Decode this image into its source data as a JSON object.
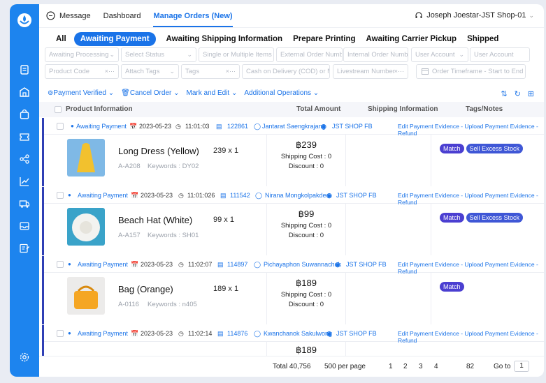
{
  "top_nav": {
    "items": [
      "Message",
      "Dashboard",
      "Manage Orders (New)"
    ],
    "user": "Joseph Joestar-JST Shop-01"
  },
  "status_tabs": [
    "All",
    "Awaiting Payment",
    "Awaiting Shipping Information",
    "Prepare Printing",
    "Awaiting Carrier Pickup",
    "Shipped"
  ],
  "filters": {
    "row1": [
      "Awaiting Processing",
      "Select Status",
      "Single or Multiple Items",
      "External Order Number",
      "Internal Order Number",
      "User Account",
      "User Account"
    ],
    "row2": [
      "Product Code",
      "Attach Tags",
      "Tags",
      "Cash on Delivery (COD) or Not",
      "Livestream Number",
      "Order Timeframe - Start to End"
    ]
  },
  "actions": [
    "Payment Verified",
    "Cancel Order",
    "Mark and Edit",
    "Additional Operations"
  ],
  "table_headers": [
    "Product Information",
    "Total Amount",
    "Shipping Information",
    "Tags/Notes"
  ],
  "orders": [
    {
      "status": "Awaiting Payment",
      "date": "2023-05-23",
      "time": "11:01:03",
      "order_no": "122861",
      "customer": "Jantarat Saengkrajang",
      "shop": "JST SHOP FB",
      "ops": "Edit Payment Evidence - Upload Payment Evidence - Refund",
      "product": "Long Dress (Yellow)",
      "qty": "239 x 1",
      "code": "A-A208",
      "keywords": "Keywords : DY02",
      "amount": "฿239",
      "shipping_cost": "Shipping Cost : 0",
      "discount": "Discount : 0",
      "tags": [
        "Match",
        "Sell Excess Stock"
      ]
    },
    {
      "status": "Awaiting Payment",
      "date": "2023-05-23",
      "time": "11:01:026",
      "order_no": "111542",
      "customer": "Nirana Mongkolpakdee",
      "shop": "JST SHOP FB",
      "ops": "Edit Payment Evidence - Upload Payment Evidence - Refund",
      "product": "Beach Hat (White)",
      "qty": "99 x 1",
      "code": "A-A157",
      "keywords": "Keywords : SH01",
      "amount": "฿99",
      "shipping_cost": "Shipping Cost : 0",
      "discount": "Discount : 0",
      "tags": [
        "Match",
        "Sell Excess Stock"
      ]
    },
    {
      "status": "Awaiting Payment",
      "date": "2023-05-23",
      "time": "11:02:07",
      "order_no": "114897",
      "customer": "Pichayaphon Suwannachok",
      "shop": "JST SHOP FB",
      "ops": "Edit Payment Evidence - Upload Payment Evidence - Refund",
      "product": "Bag (Orange)",
      "qty": "189 x 1",
      "code": "A-0116",
      "keywords": "Keywords : n405",
      "amount": "฿189",
      "shipping_cost": "Shipping Cost : 0",
      "discount": "Discount : 0",
      "tags": [
        "Match"
      ]
    },
    {
      "status": "Awaiting Payment",
      "date": "2023-05-23",
      "time": "11:02:14",
      "order_no": "114876",
      "customer": "Kwanchanok Sakulwong",
      "shop": "JST SHOP FB",
      "ops": "Edit Payment Evidence - Upload Payment Evidence - Refund",
      "amount": "฿189"
    }
  ],
  "footer": {
    "total": "Total 40,756",
    "per_page": "500 per page",
    "pages": [
      "1",
      "2",
      "3",
      "4",
      "82"
    ],
    "goto_label": "Go to",
    "goto_value": "1"
  },
  "colors": {
    "primary": "#1a73e8",
    "sidebar": "#1d84ee",
    "row_accent": "#2f3fb5",
    "tag": "#4b3fd1"
  }
}
